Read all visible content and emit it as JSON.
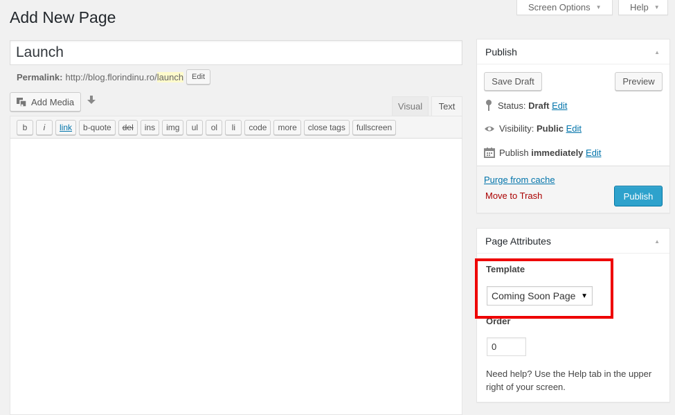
{
  "header": {
    "page_title": "Add New Page",
    "screen_options": "Screen Options",
    "help": "Help"
  },
  "title_field": {
    "value": "Launch"
  },
  "permalink": {
    "label": "Permalink:",
    "base": "http://blog.florindinu.ro/",
    "slug": "launch",
    "edit": "Edit"
  },
  "editor": {
    "add_media": "Add Media",
    "tabs": {
      "visual": "Visual",
      "text": "Text"
    },
    "quicktags": [
      "b",
      "i",
      "link",
      "b-quote",
      "del",
      "ins",
      "img",
      "ul",
      "ol",
      "li",
      "code",
      "more",
      "close tags",
      "fullscreen"
    ]
  },
  "publish": {
    "title": "Publish",
    "save_draft": "Save Draft",
    "preview": "Preview",
    "status_label": "Status:",
    "status_value": "Draft",
    "visibility_label": "Visibility:",
    "visibility_value": "Public",
    "publish_label": "Publish",
    "publish_value": "immediately",
    "edit": "Edit",
    "purge": "Purge from cache",
    "trash": "Move to Trash",
    "publish_button": "Publish"
  },
  "attributes": {
    "title": "Page Attributes",
    "template_label": "Template",
    "template_value": "Coming Soon Page",
    "order_label": "Order",
    "order_value": "0",
    "help_text": "Need help? Use the Help tab in the upper right of your screen."
  },
  "colors": {
    "primary": "#2ea2cc",
    "link": "#0073aa",
    "trash": "#a00",
    "highlight": "#e00"
  }
}
